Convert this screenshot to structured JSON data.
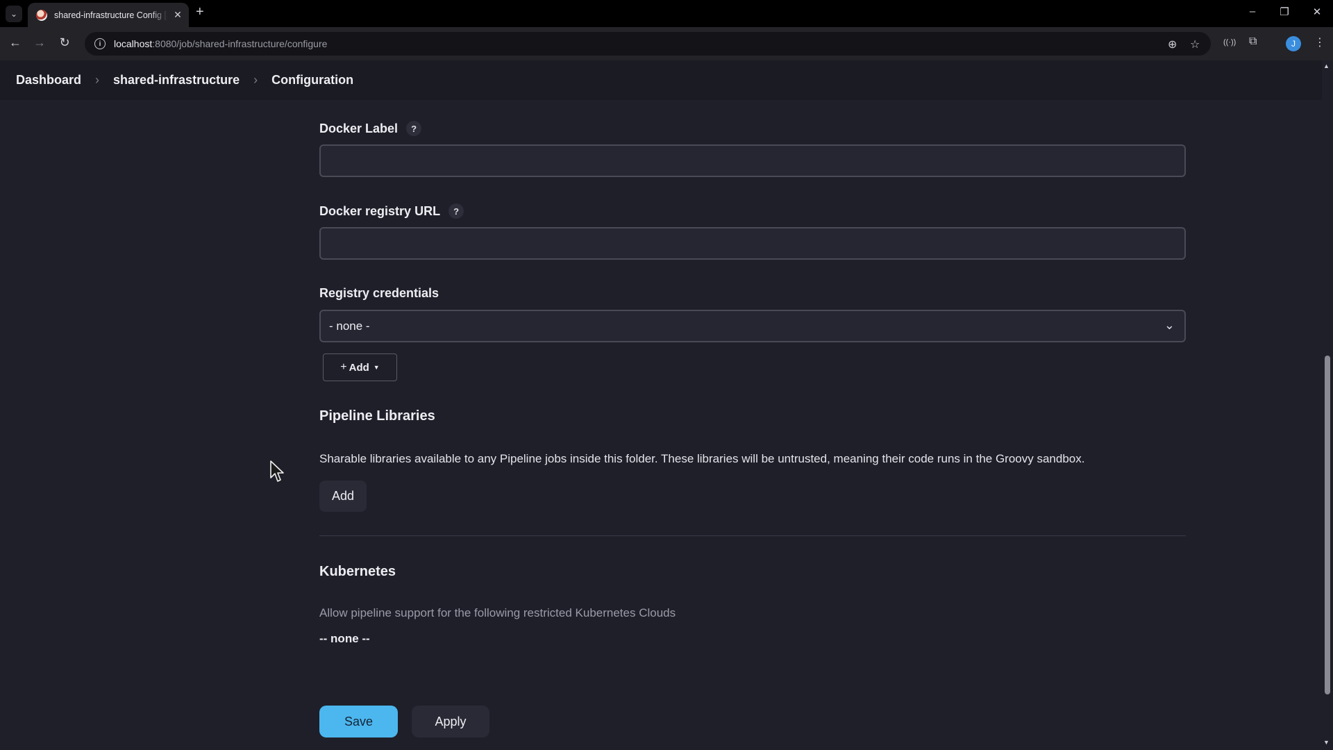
{
  "browser": {
    "tab": {
      "title": "shared-infrastructure Config [Jenkins]"
    },
    "address": {
      "host": "localhost",
      "rest": ":8080/job/shared-infrastructure/configure"
    }
  },
  "breadcrumbs": [
    "Dashboard",
    "shared-infrastructure",
    "Configuration"
  ],
  "docker_label": {
    "label": "Docker Label",
    "help": "?",
    "value": ""
  },
  "docker_registry": {
    "label": "Docker registry URL",
    "help": "?",
    "value": ""
  },
  "registry_credentials": {
    "label": "Registry credentials",
    "selected": "- none -",
    "add_label": "Add"
  },
  "pipeline_libraries": {
    "title": "Pipeline Libraries",
    "description": "Sharable libraries available to any Pipeline jobs inside this folder. These libraries will be untrusted, meaning their code runs in the Groovy sandbox.",
    "add_label": "Add"
  },
  "kubernetes": {
    "title": "Kubernetes",
    "description": "Allow pipeline support for the following restricted Kubernetes Clouds",
    "none_text": "-- none --"
  },
  "actions": {
    "save_label": "Save",
    "apply_label": "Apply"
  },
  "profile": {
    "initial": "J"
  },
  "colors": {
    "accent": "#4cb7ef",
    "background": "#1f1f2a"
  }
}
